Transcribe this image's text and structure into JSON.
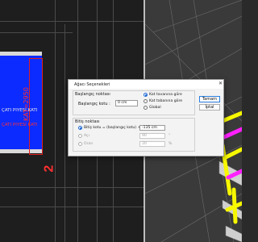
{
  "plan": {
    "labels": [
      "ÇATI PIYESİ KATI",
      "ÇATI PIYESİ KATI"
    ],
    "dimension": "KAT=2950",
    "marker": "2"
  },
  "dialog": {
    "title": "Ağacı Seçenekleri",
    "start_group": "Başlangıç noktası",
    "start_label": "Başlangıç kotu :",
    "start_value": "0 cm",
    "start_options": [
      "Kat tavanına göre",
      "Kat tabanına göre",
      "Global"
    ],
    "start_selected": 0,
    "end_group": "Bitiş noktası",
    "end_options": [
      {
        "label": "Bitiş kotu = (başlangıç kotu) +",
        "value": "-135 cm",
        "enabled": true
      },
      {
        "label": "Açı",
        "value": "90",
        "enabled": false
      },
      {
        "label": "Oran",
        "value": "20",
        "enabled": false
      }
    ],
    "end_selected": 0,
    "ok_label": "Tamam",
    "cancel_label": "İptal",
    "angle_unit": "°",
    "ratio_unit": "%"
  }
}
